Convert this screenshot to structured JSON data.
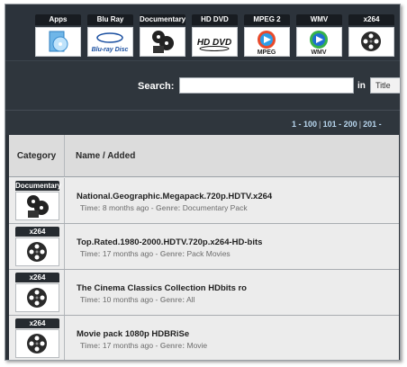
{
  "categories": [
    {
      "label": "Apps",
      "icon": "apps-icon"
    },
    {
      "label": "Blu Ray",
      "icon": "bluray-icon"
    },
    {
      "label": "Documentary",
      "icon": "film-reel-icon"
    },
    {
      "label": "HD DVD",
      "icon": "hddvd-icon"
    },
    {
      "label": "MPEG 2",
      "icon": "mpeg-icon"
    },
    {
      "label": "WMV",
      "icon": "wmv-icon"
    },
    {
      "label": "x264",
      "icon": "film-reel-icon"
    }
  ],
  "category_logo_text": {
    "bluray": "Blu-ray Disc",
    "hddvd": "HD DVD",
    "mpeg": "MPEG",
    "wmv": "WMV"
  },
  "search": {
    "label": "Search:",
    "value": "",
    "in_label": "in",
    "field": "Title"
  },
  "pagination": {
    "p1": "1 - 100",
    "p2": "101 - 200",
    "p3": "201 -"
  },
  "table": {
    "col_category": "Category",
    "col_name": "Name / Added",
    "time_label": "Time:",
    "genre_label": "Genre:",
    "rows": [
      {
        "category": "Documentary",
        "title": "National.Geographic.Megapack.720p.HDTV.x264",
        "time": "8 months ago",
        "genre": "Documentary Pack"
      },
      {
        "category": "x264",
        "title": "Top.Rated.1980-2000.HDTV.720p.x264-HD-bits",
        "time": "17 months ago",
        "genre": "Pack Movies"
      },
      {
        "category": "x264",
        "title": "The Cinema Classics Collection HDbits ro",
        "time": "10 months ago",
        "genre": "All"
      },
      {
        "category": "x264",
        "title": "Movie pack 1080p HDBRiSe",
        "time": "17 months ago",
        "genre": "Movie"
      }
    ]
  },
  "colors": {
    "header_bg": "#2c333b",
    "table_bg": "#ececec",
    "link": "#b8d6ee"
  }
}
